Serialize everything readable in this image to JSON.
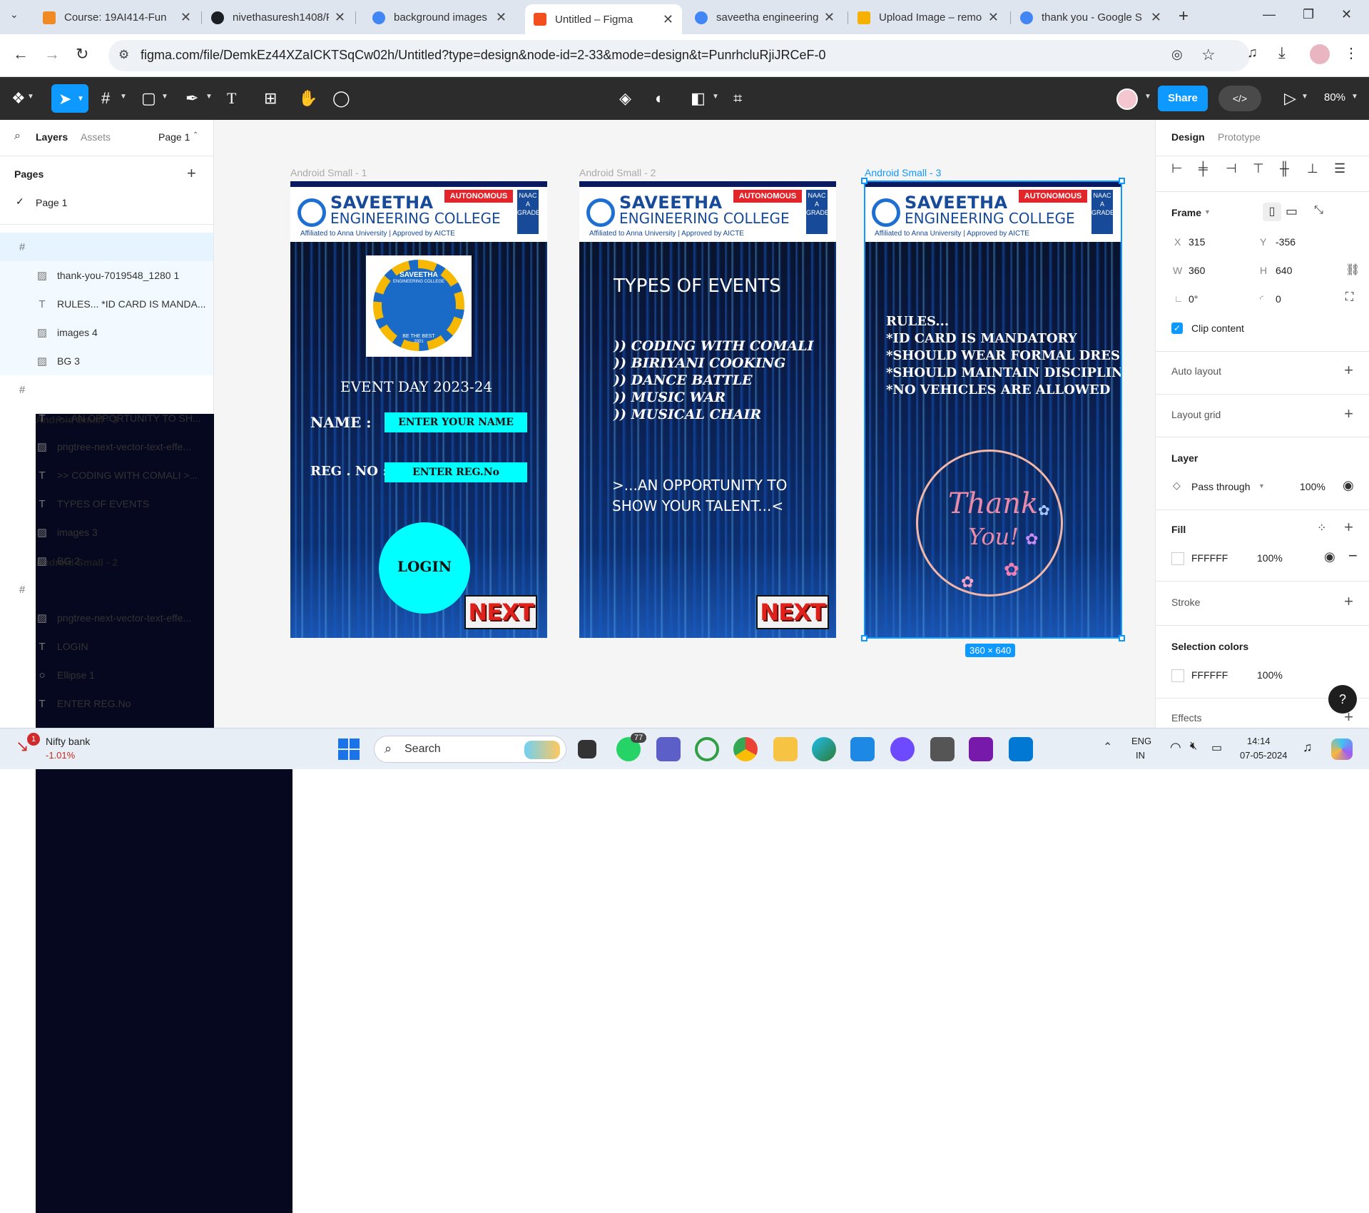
{
  "browser": {
    "tabs": [
      {
        "title": "Course: 19AI414-Fun",
        "color": "#f08a24"
      },
      {
        "title": "nivethasuresh1408/F",
        "color": "#1b1f23"
      },
      {
        "title": "background images v",
        "color": "#4285f4"
      },
      {
        "title": "Untitled – Figma",
        "color": "#f24e1e"
      },
      {
        "title": "saveetha engineering",
        "color": "#4285f4"
      },
      {
        "title": "Upload Image – remo",
        "color": "#f6b100"
      },
      {
        "title": "thank you - Google S",
        "color": "#4285f4"
      }
    ],
    "url": "figma.com/file/DemkEz44XZaICKTSqCw02h/Untitled?type=design&node-id=2-33&mode=design&t=PunrhcluRjiJRCeF-0"
  },
  "toolbar": {
    "share_label": "Share",
    "dev_label": "</>",
    "zoom": "80%"
  },
  "left_panel": {
    "tab_layers": "Layers",
    "tab_assets": "Assets",
    "page_selector": "Page 1",
    "pages_heading": "Pages",
    "page_item": "Page 1",
    "layers": [
      {
        "name": "Android Small - 3",
        "type": "frame"
      },
      {
        "name": "thank-you-7019548_1280 1",
        "type": "image"
      },
      {
        "name": "RULES... *ID CARD IS MANDA...",
        "type": "text"
      },
      {
        "name": "images 4",
        "type": "image"
      },
      {
        "name": "BG 3",
        "type": "image"
      },
      {
        "name": "Android Small - 2",
        "type": "frame"
      },
      {
        "name": ">...AN OPPORTUNITY TO SH...",
        "type": "text"
      },
      {
        "name": "pngtree-next-vector-text-effe...",
        "type": "image"
      },
      {
        "name": ">> CODING WITH COMALI >...",
        "type": "text"
      },
      {
        "name": "TYPES OF EVENTS",
        "type": "text"
      },
      {
        "name": "images 3",
        "type": "image"
      },
      {
        "name": "BG 2",
        "type": "image"
      },
      {
        "name": "Android Small - 1",
        "type": "frame"
      },
      {
        "name": "pngtree-next-vector-text-effe...",
        "type": "image"
      },
      {
        "name": "LOGIN",
        "type": "text"
      },
      {
        "name": "Ellipse 1",
        "type": "ellipse"
      },
      {
        "name": "ENTER REG.No",
        "type": "text"
      }
    ]
  },
  "canvas": {
    "frame_labels": [
      "Android Small - 1",
      "Android Small - 2",
      "Android Small - 3"
    ],
    "size_badge": "360 × 640",
    "college": {
      "name_line1": "SAVEETHA",
      "name_line2": "ENGINEERING COLLEGE",
      "affiliation": "Affiliated to Anna University | Approved by AICTE",
      "autonomous": "AUTONOMOUS",
      "naac": "NAAC A GRADE"
    },
    "frame1": {
      "logo_top": "SAVEETHA",
      "logo_sub": "ENGINEERING COLLEGE",
      "logo_motto": "BE THE BEST",
      "logo_year": "2001",
      "event_title": "EVENT DAY 2023-24",
      "name_label": "NAME :",
      "name_input": "ENTER YOUR NAME",
      "reg_label": "REG . NO :",
      "reg_input": "ENTER REG.No",
      "login": "LOGIN",
      "next": "NEXT"
    },
    "frame2": {
      "heading": "TYPES OF EVENTS",
      "events": [
        ")) CODING WITH COMALI",
        ")) BIRIYANI COOKING",
        ")) DANCE BATTLE",
        ")) MUSIC WAR",
        ")) MUSICAL CHAIR"
      ],
      "tagline1": ">...AN OPPORTUNITY TO",
      "tagline2": "SHOW YOUR TALENT...<",
      "next": "NEXT"
    },
    "frame3": {
      "rules": [
        "RULES...",
        "*ID CARD IS MANDATORY",
        "*SHOULD WEAR FORMAL DRESS",
        "*SHOULD MAINTAIN DISCIPLINE",
        "*NO VEHICLES ARE ALLOWED"
      ],
      "thank1": "Thank",
      "thank2": "You!"
    }
  },
  "right_panel": {
    "tab_design": "Design",
    "tab_prototype": "Prototype",
    "frame_label": "Frame",
    "x_label": "X",
    "x": "315",
    "y_label": "Y",
    "y": "-356",
    "w_label": "W",
    "w": "360",
    "h_label": "H",
    "h": "640",
    "rotation": "0°",
    "radius": "0",
    "clip_content": "Clip content",
    "auto_layout": "Auto layout",
    "layout_grid": "Layout grid",
    "layer": "Layer",
    "blend": "Pass through",
    "layer_opacity": "100%",
    "fill": "Fill",
    "fill_hex": "FFFFFF",
    "fill_opacity": "100%",
    "stroke": "Stroke",
    "selection_colors": "Selection colors",
    "sel_hex": "FFFFFF",
    "sel_opacity": "100%",
    "effects": "Effects"
  },
  "taskbar": {
    "stock_name": "Nifty bank",
    "stock_change": "-1.01%",
    "search": "Search",
    "whatsapp_badge": "77",
    "lang1": "ENG",
    "lang2": "IN",
    "time": "14:14",
    "date": "07-05-2024"
  },
  "colors": {
    "figma_blue": "#0d99ff",
    "toolbar": "#2c2c2c",
    "cyan": "#00ffff",
    "next_red": "#e0201a"
  }
}
